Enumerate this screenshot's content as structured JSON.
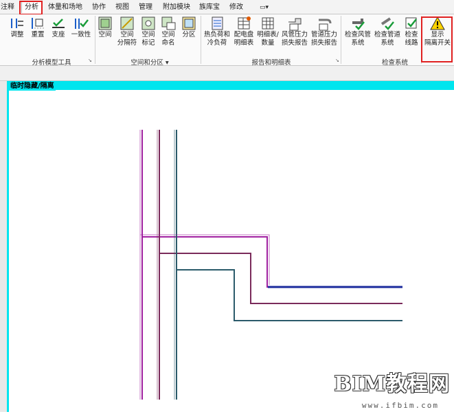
{
  "tabs": [
    "注释",
    "分析",
    "体量和场地",
    "协作",
    "视图",
    "管理",
    "附加模块",
    "族库宝",
    "修改"
  ],
  "tools": {
    "adjust": "调整",
    "reset": "重置",
    "support": "支座",
    "consistency": "一致性",
    "space": "空间",
    "space_sep_1": "空间",
    "space_sep_2": "分隔符",
    "space_tag_1": "空间",
    "space_tag_2": "标记",
    "space_name_1": "空间",
    "space_name_2": "命名",
    "zone": "分区",
    "heat_1": "热负荷和",
    "heat_2": "冷负荷",
    "panel_1": "配电盘",
    "panel_2": "明细表",
    "sched_1": "明细表/",
    "sched_2": "数量",
    "duct_1": "风管压力",
    "duct_2": "损失报告",
    "pipe_1": "管道压力",
    "pipe_2": "损失报告",
    "chk_duct_1": "检查风管",
    "chk_duct_2": "系统",
    "chk_pipe_1": "检查管道",
    "chk_pipe_2": "系统",
    "chk_circ_1": "检查",
    "chk_circ_2": "线路",
    "show_1": "显示",
    "show_2": "隔离开关"
  },
  "groups": {
    "analytic": "分析模型工具",
    "spaces": "空间和分区",
    "reports": "报告和明细表",
    "check": "检查系统"
  },
  "view": {
    "label": "临时隐藏/隔离"
  },
  "watermark": {
    "title": "BIM教程网",
    "url": "www.ifbim.com"
  }
}
